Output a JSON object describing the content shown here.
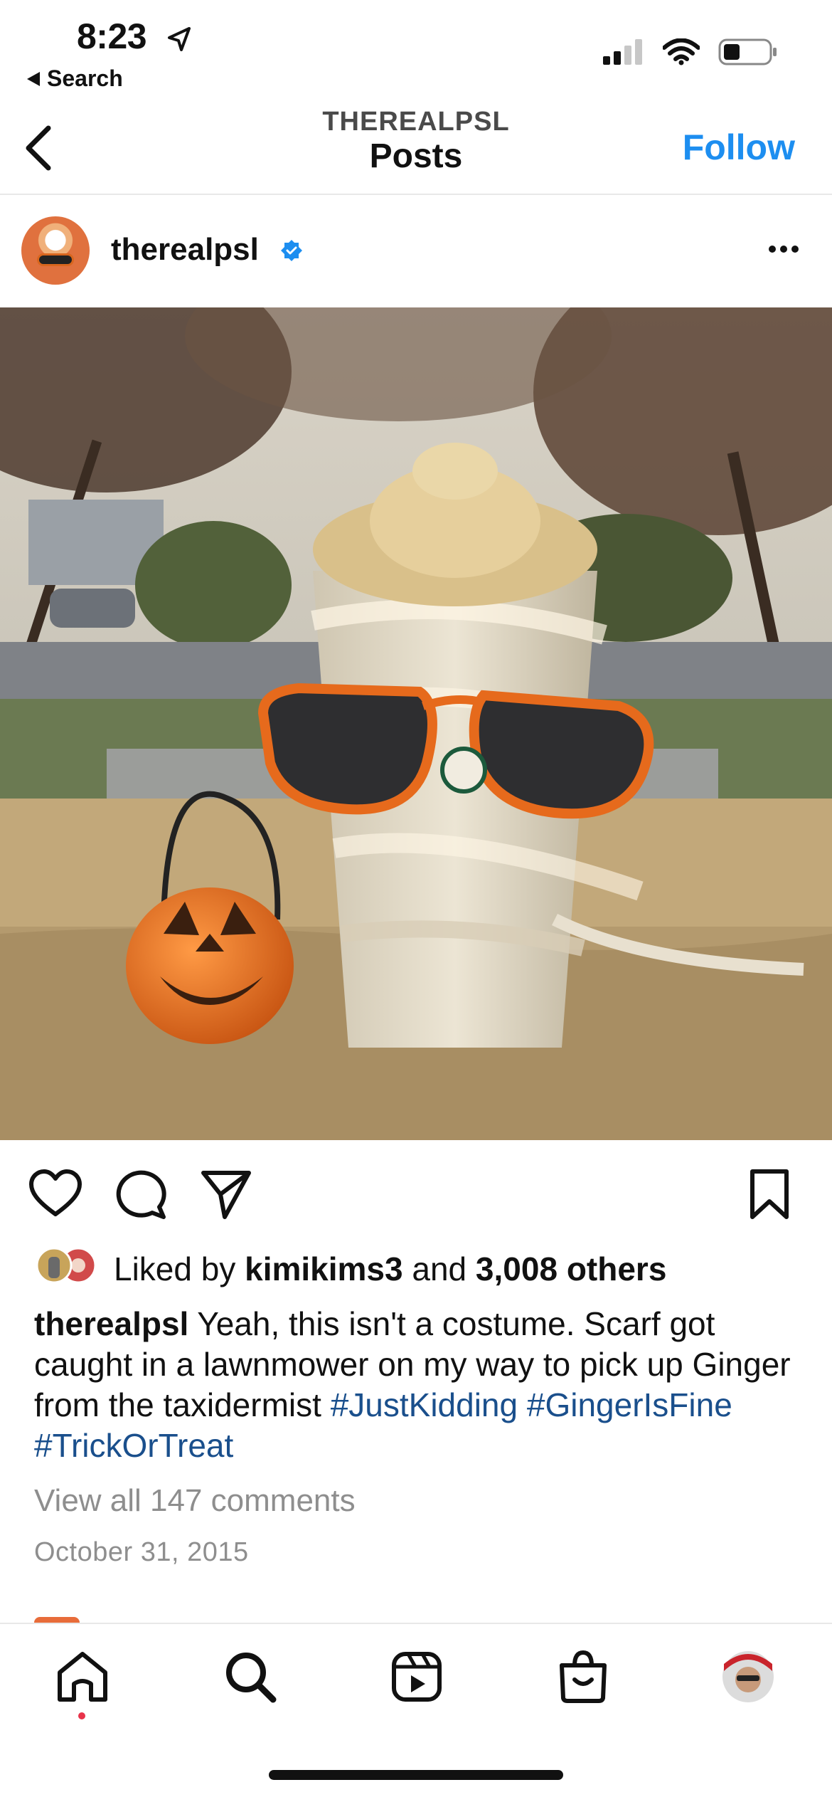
{
  "status_bar": {
    "time": "8:23",
    "back_app": "Search"
  },
  "header": {
    "account_caps": "THEREALPSL",
    "title": "Posts",
    "follow": "Follow"
  },
  "post": {
    "username": "therealpsl",
    "likes": {
      "prefix": "Liked by ",
      "user": "kimikims3",
      "middle": " and ",
      "others": "3,008 others"
    },
    "caption": {
      "username": "therealpsl",
      "text": " Yeah, this isn't a costume. Scarf got caught in a lawnmower on my way to pick up Ginger from the taxidermist ",
      "tags": [
        "#JustKidding",
        "#GingerIsFine",
        "#TrickOrTreat"
      ]
    },
    "view_comments": "View all 147 comments",
    "date": "October 31, 2015"
  },
  "icons": {
    "location": "location-arrow-icon",
    "signal": "cell-signal-icon",
    "wifi": "wifi-icon",
    "battery": "battery-icon",
    "back": "chevron-left-icon",
    "verified": "verified-badge-icon",
    "more": "more-horizontal-icon",
    "like": "heart-icon",
    "comment": "comment-icon",
    "share": "send-icon",
    "save": "bookmark-icon",
    "home": "home-icon",
    "search": "search-icon",
    "reels": "reels-icon",
    "shop": "shop-bag-icon"
  },
  "colors": {
    "accent": "#1d8ef0",
    "hashtag": "#1a4f8c",
    "muted": "#8e8e8e",
    "notification": "#e8334a"
  }
}
